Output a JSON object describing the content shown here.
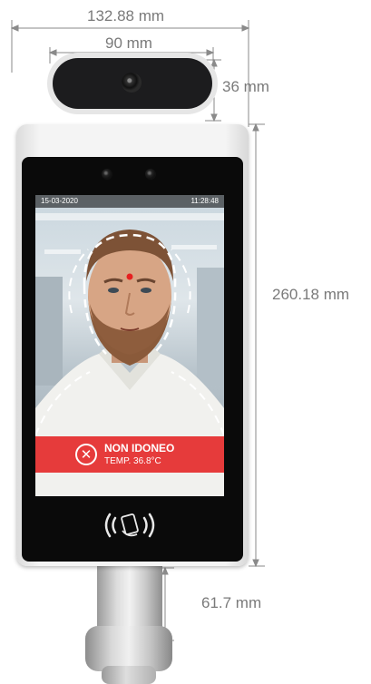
{
  "dimensions": {
    "overall_width": "132.88 mm",
    "camera_width": "90 mm",
    "camera_height": "36 mm",
    "screen_height": "260.18 mm",
    "pole_height": "61.7 mm"
  },
  "screen": {
    "date": "15-03-2020",
    "time": "11:28:48",
    "status_title": "NON IDONEO",
    "status_temp": "TEMP. 36.8°C",
    "status_icon": "x-circle-icon"
  },
  "colors": {
    "alert": "#e63b3b",
    "bezel": "#0a0a0a",
    "dimension_lines": "#7a7a7a",
    "scan_dot": "#e62020"
  }
}
